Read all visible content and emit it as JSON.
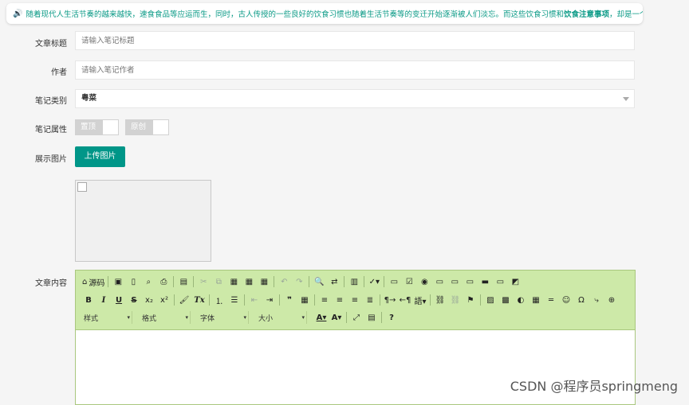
{
  "notice": {
    "icon": "speaker-icon",
    "text": "随着现代人生活节奏的越来越快，速食食品等应运而生，同时，古人传授的一些良好的饮食习惯也随着生活节奏等的变迁开始逐渐被人们淡忘。而这些饮食习惯和",
    "bold": "饮食注意事项",
    "tail": "，却是一个人良好素"
  },
  "form": {
    "title_label": "文章标题",
    "title_placeholder": "请输入笔记标题",
    "author_label": "作者",
    "author_placeholder": "请输入笔记作者",
    "category_label": "笔记类别",
    "category_value": "粤菜",
    "attr_label": "笔记属性",
    "attr_top": "置顶",
    "attr_original": "原创",
    "image_label": "展示图片",
    "upload_button": "上传图片",
    "content_label": "文章内容"
  },
  "editor": {
    "row1": [
      {
        "name": "source-button",
        "glyph": "⌂",
        "label": "源码"
      },
      {
        "sep": true
      },
      {
        "name": "save-icon",
        "glyph": "▣"
      },
      {
        "name": "new-page-icon",
        "glyph": "▯"
      },
      {
        "name": "preview-icon",
        "glyph": "⌕"
      },
      {
        "name": "print-icon",
        "glyph": "⎙"
      },
      {
        "sep": true
      },
      {
        "name": "templates-icon",
        "glyph": "▤"
      },
      {
        "sep": true
      },
      {
        "name": "cut-icon",
        "glyph": "✂",
        "dim": true
      },
      {
        "name": "copy-icon",
        "glyph": "⧉",
        "dim": true
      },
      {
        "name": "paste-icon",
        "glyph": "▦"
      },
      {
        "name": "paste-text-icon",
        "glyph": "▦"
      },
      {
        "name": "paste-word-icon",
        "glyph": "▦"
      },
      {
        "sep": true
      },
      {
        "name": "undo-icon",
        "glyph": "↶",
        "dim": true
      },
      {
        "name": "redo-icon",
        "glyph": "↷",
        "dim": true
      },
      {
        "sep": true
      },
      {
        "name": "find-icon",
        "glyph": "🔍"
      },
      {
        "name": "replace-icon",
        "glyph": "⇄"
      },
      {
        "sep": true
      },
      {
        "name": "select-all-icon",
        "glyph": "▥"
      },
      {
        "sep": true
      },
      {
        "name": "spellcheck-icon",
        "glyph": "✓▾"
      },
      {
        "sep": true
      },
      {
        "name": "form-icon",
        "glyph": "▭"
      },
      {
        "name": "checkbox-icon",
        "glyph": "☑"
      },
      {
        "name": "radio-icon",
        "glyph": "◉"
      },
      {
        "name": "textfield-icon",
        "glyph": "▭"
      },
      {
        "name": "textarea-icon",
        "glyph": "▭"
      },
      {
        "name": "select-field-icon",
        "glyph": "▭"
      },
      {
        "name": "button-field-icon",
        "glyph": "▬"
      },
      {
        "name": "image-button-icon",
        "glyph": "▭"
      },
      {
        "name": "hidden-field-icon",
        "glyph": "◩"
      }
    ],
    "row2": [
      {
        "name": "bold-button",
        "glyph": "B",
        "cls": "bold"
      },
      {
        "name": "italic-button",
        "glyph": "I",
        "cls": "ital"
      },
      {
        "name": "underline-button",
        "glyph": "U",
        "cls": "under"
      },
      {
        "name": "strike-button",
        "glyph": "S",
        "cls": "strike"
      },
      {
        "name": "subscript-icon",
        "glyph": "x₂"
      },
      {
        "name": "superscript-icon",
        "glyph": "x²"
      },
      {
        "sep": true
      },
      {
        "name": "copy-format-icon",
        "glyph": "🖌"
      },
      {
        "name": "remove-format-icon",
        "glyph": "Tx",
        "cls": "ital"
      },
      {
        "sep": true
      },
      {
        "name": "numbered-list-icon",
        "glyph": "⒈"
      },
      {
        "name": "bulleted-list-icon",
        "glyph": "☰"
      },
      {
        "sep": true
      },
      {
        "name": "outdent-icon",
        "glyph": "⇤",
        "dim": true
      },
      {
        "name": "indent-icon",
        "glyph": "⇥"
      },
      {
        "sep": true
      },
      {
        "name": "blockquote-icon",
        "glyph": "❞",
        "cls": "bold"
      },
      {
        "name": "div-icon",
        "glyph": "▦"
      },
      {
        "sep": true
      },
      {
        "name": "align-left-icon",
        "glyph": "≡"
      },
      {
        "name": "align-center-icon",
        "glyph": "≡"
      },
      {
        "name": "align-right-icon",
        "glyph": "≡"
      },
      {
        "name": "justify-icon",
        "glyph": "≣"
      },
      {
        "sep": true
      },
      {
        "name": "ltr-icon",
        "glyph": "¶→"
      },
      {
        "name": "rtl-icon",
        "glyph": "←¶"
      },
      {
        "name": "language-icon",
        "glyph": "語▾"
      },
      {
        "sep": true
      },
      {
        "name": "link-icon",
        "glyph": "⛓"
      },
      {
        "name": "unlink-icon",
        "glyph": "⛓",
        "dim": true
      },
      {
        "name": "anchor-icon",
        "glyph": "⚑"
      },
      {
        "sep": true
      },
      {
        "name": "image-icon",
        "glyph": "▨"
      },
      {
        "name": "flash-icon",
        "glyph": "▩"
      },
      {
        "name": "iframe-icon",
        "glyph": "◐"
      },
      {
        "name": "table-icon",
        "glyph": "▦"
      },
      {
        "name": "horizontal-rule-icon",
        "glyph": "═"
      },
      {
        "name": "smiley-icon",
        "glyph": "☺"
      },
      {
        "name": "special-char-icon",
        "glyph": "Ω"
      },
      {
        "name": "page-break-icon",
        "glyph": "⤷"
      },
      {
        "name": "iframe-globe-icon",
        "glyph": "⊕"
      }
    ],
    "row3": [
      {
        "name": "styles-combo",
        "label": "样式",
        "w": 58
      },
      {
        "name": "format-combo",
        "label": "格式",
        "w": 58
      },
      {
        "name": "font-combo",
        "label": "字体",
        "w": 58
      },
      {
        "name": "size-combo",
        "label": "大小",
        "w": 58
      }
    ],
    "row3_icons": [
      {
        "name": "text-color-icon",
        "glyph": "A▾",
        "cls": "under"
      },
      {
        "name": "bg-color-icon",
        "glyph": "A▾",
        "cls": "bold"
      },
      {
        "sep": true
      },
      {
        "name": "maximize-icon",
        "glyph": "⤢"
      },
      {
        "name": "show-blocks-icon",
        "glyph": "▤"
      },
      {
        "sep": true
      },
      {
        "name": "about-icon",
        "glyph": "?",
        "cls": "bold"
      }
    ]
  },
  "watermark": "CSDN @程序员springmeng"
}
